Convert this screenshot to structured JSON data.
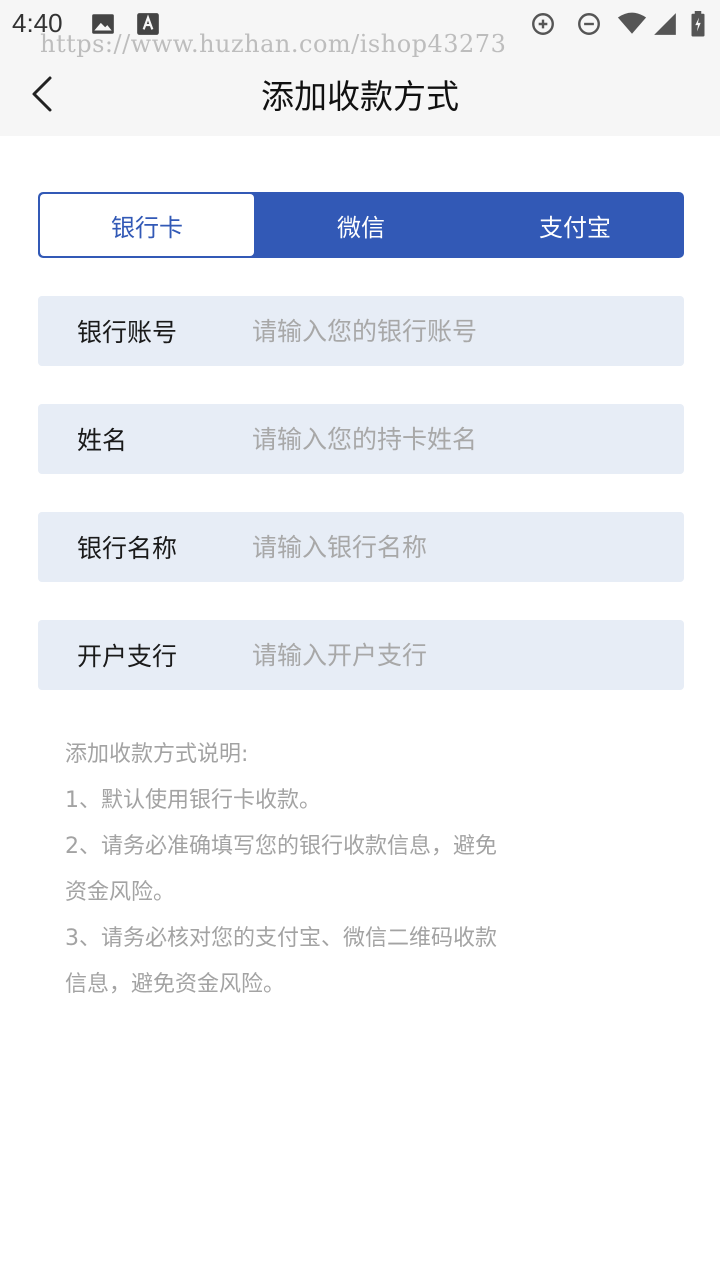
{
  "status_bar": {
    "time": "4:40",
    "watermark": "https://www.huzhan.com/ishop43273",
    "icons": [
      "image-icon",
      "text-a-icon",
      "data-saver-icon",
      "dnd-icon",
      "wifi-icon",
      "signal-icon",
      "battery-icon"
    ]
  },
  "nav": {
    "title": "添加收款方式",
    "back_icon": "chevron-left-icon"
  },
  "tabs": [
    {
      "label": "银行卡",
      "active": true
    },
    {
      "label": "微信",
      "active": false
    },
    {
      "label": "支付宝",
      "active": false
    }
  ],
  "form": {
    "account": {
      "label": "银行账号",
      "placeholder": "请输入您的银行账号",
      "value": ""
    },
    "name": {
      "label": "姓名",
      "placeholder": "请输入您的持卡姓名",
      "value": ""
    },
    "bank": {
      "label": "银行名称",
      "placeholder": "请输入银行名称",
      "value": ""
    },
    "branch": {
      "label": "开户支行",
      "placeholder": "请输入开户支行",
      "value": ""
    }
  },
  "notes": {
    "title": "添加收款方式说明:",
    "line1": "1、默认使用银行卡收款。",
    "line2a": "2、请务必准确填写您的银行收款信息，避免",
    "line2b": "资金风险。",
    "line3a": "3、请务必核对您的支付宝、微信二维码收款",
    "line3b": "信息，避免资金风险。"
  },
  "colors": {
    "accent": "#3259b6",
    "field_bg": "#e7edf6",
    "placeholder": "#a8a8a8",
    "note_text": "#a3a3a3"
  }
}
